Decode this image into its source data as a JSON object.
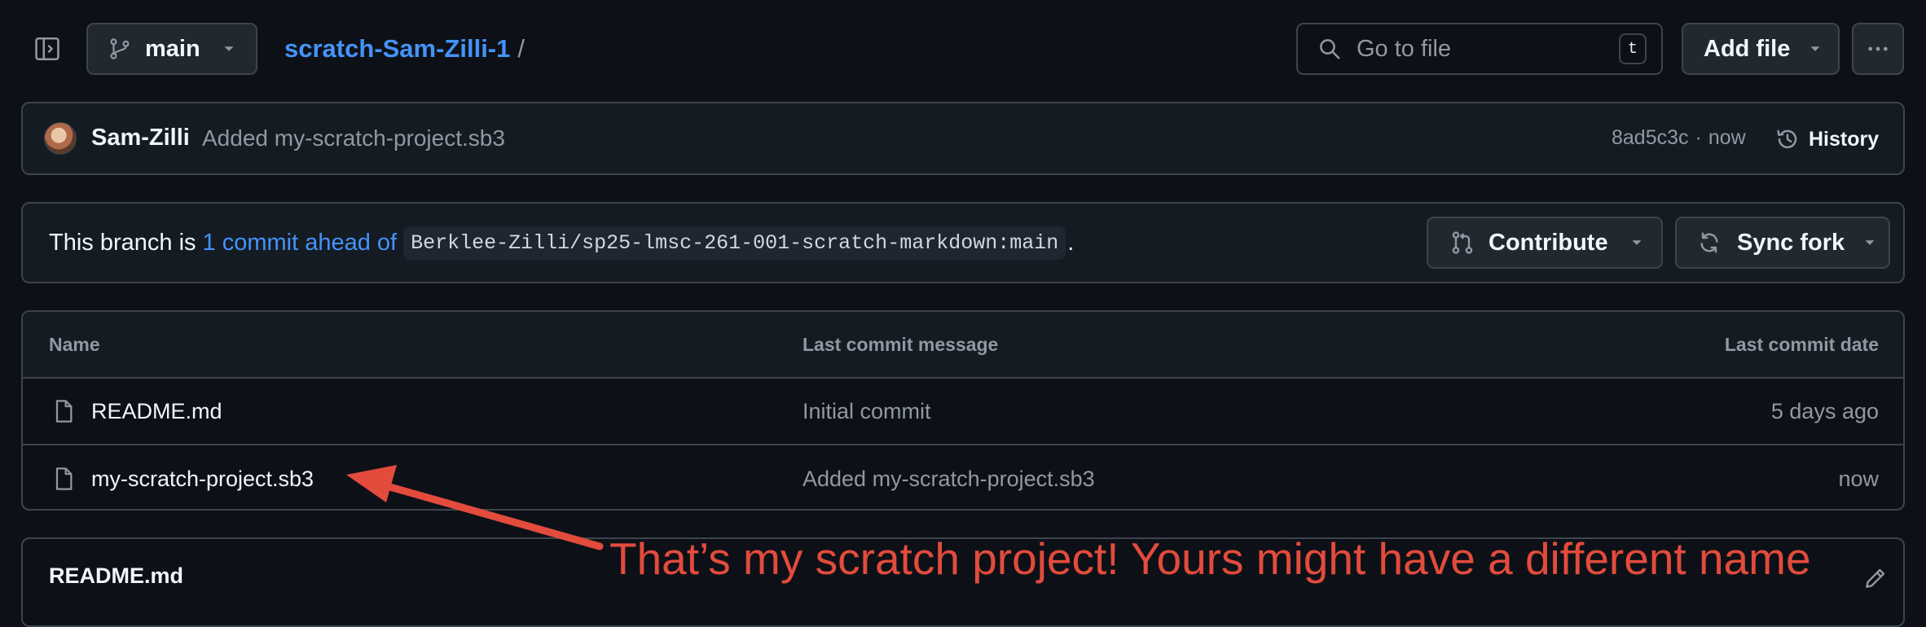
{
  "top_bar": {
    "branch_name": "main",
    "repo_name": "scratch-Sam-Zilli-1",
    "path_separator": "/",
    "search_placeholder": "Go to file",
    "search_shortcut": "t",
    "add_file_label": "Add file"
  },
  "latest_commit": {
    "author": "Sam-Zilli",
    "message": "Added my-scratch-project.sb3",
    "hash": "8ad5c3c",
    "separator": "·",
    "time": "now",
    "history_label": "History"
  },
  "branch_status": {
    "prefix": "This branch is",
    "ahead_link": "1 commit ahead of",
    "upstream": "Berklee-Zilli/sp25-lmsc-261-001-scratch-markdown:main",
    "suffix": ".",
    "contribute_label": "Contribute",
    "sync_fork_label": "Sync fork"
  },
  "file_table": {
    "columns": [
      "Name",
      "Last commit message",
      "Last commit date"
    ],
    "rows": [
      {
        "name": "README.md",
        "message": "Initial commit",
        "date": "5 days ago"
      },
      {
        "name": "my-scratch-project.sb3",
        "message": "Added my-scratch-project.sb3",
        "date": "now"
      }
    ]
  },
  "readme": {
    "title": "README.md"
  },
  "annotation": {
    "text": "That’s my scratch project! Yours might have a different name",
    "color": "#e34b3c"
  },
  "colors": {
    "background": "#0d1117",
    "border": "#3d444d",
    "link": "#4493f8",
    "muted": "#9198a1"
  },
  "icons": [
    "sidebar-toggle-icon",
    "git-branch-icon",
    "caret-down-icon",
    "search-icon",
    "kebab-horizontal-icon",
    "history-icon",
    "git-pull-request-icon",
    "sync-icon",
    "file-icon",
    "pencil-icon"
  ]
}
